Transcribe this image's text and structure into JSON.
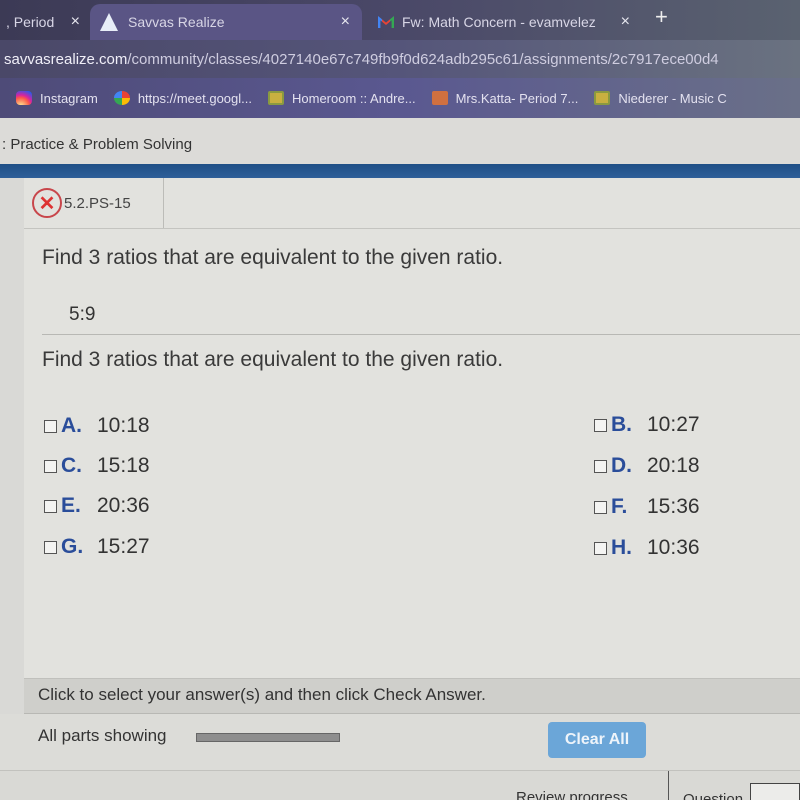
{
  "browser": {
    "tabs": [
      {
        "label": ", Period",
        "close": "×"
      },
      {
        "label": "Savvas Realize",
        "close": "×",
        "active": true
      },
      {
        "label": "Fw: Math Concern - evamvelez",
        "close": "×"
      }
    ],
    "new_tab": "+",
    "url_host": "savvasrealize.com",
    "url_path": "/community/classes/4027140e67c749fb9f0d624adb295c61/assignments/2c7917ece00d4",
    "bookmarks": [
      {
        "label": "Instagram",
        "icon": "instagram-icon"
      },
      {
        "label": "https://meet.googl...",
        "icon": "google-meet-icon"
      },
      {
        "label": "Homeroom :: Andre...",
        "icon": "google-classroom-icon"
      },
      {
        "label": "Mrs.Katta- Period 7...",
        "icon": "person-icon"
      },
      {
        "label": "Niederer - Music C",
        "icon": "google-classroom-icon"
      }
    ]
  },
  "page": {
    "header": ": Practice & Problem Solving",
    "question_id": "5.2.PS-15",
    "question_status": "incorrect",
    "prompt": "Find 3 ratios that are equivalent to the given ratio.",
    "given_ratio": "5:9",
    "prompt_repeat": "Find 3 ratios that are equivalent to the given ratio.",
    "options": [
      {
        "letter": "A.",
        "value": "10:18",
        "checked": false
      },
      {
        "letter": "B.",
        "value": "10:27",
        "checked": false
      },
      {
        "letter": "C.",
        "value": "15:18",
        "checked": false
      },
      {
        "letter": "D.",
        "value": "20:18",
        "checked": false
      },
      {
        "letter": "E.",
        "value": "20:36",
        "checked": false
      },
      {
        "letter": "F.",
        "value": "15:36",
        "checked": false
      },
      {
        "letter": "G.",
        "value": "15:27",
        "checked": false
      },
      {
        "letter": "H.",
        "value": "10:36",
        "checked": false
      }
    ],
    "instructions": "Click to select your answer(s) and then click Check Answer.",
    "parts_label": "All parts showing",
    "parts_progress": 1.0,
    "clear_all": "Clear All",
    "review_progress": "Review progress",
    "question_label": "Question"
  },
  "colors": {
    "accent_blue": "#2e5f99",
    "option_letter": "#2a4d9a",
    "error_red": "#c8464b",
    "clear_button": "#6ba6d8"
  }
}
